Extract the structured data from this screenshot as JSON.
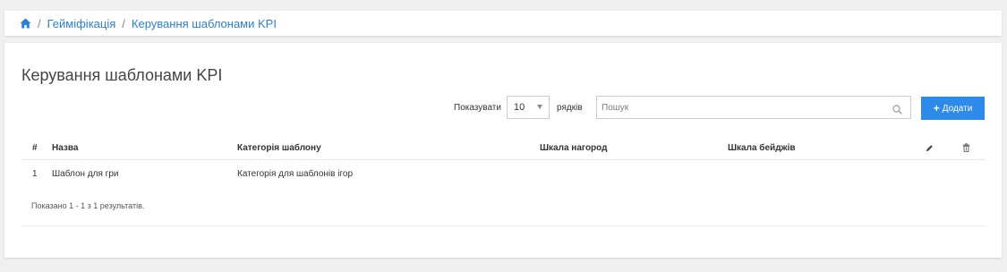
{
  "breadcrumb": {
    "home_icon": "home-icon",
    "separator": "/",
    "items": [
      "Геймiфiкацiя",
      "Керування шаблонами KPI"
    ]
  },
  "page": {
    "title": "Керування шаблонами KPI"
  },
  "controls": {
    "show_label": "Показувати",
    "page_size": "10",
    "rows_label": "рядкiв",
    "search_placeholder": "Пошук",
    "search_icon": "search-icon",
    "add_label": "Додати",
    "add_icon": "plus-icon"
  },
  "table": {
    "columns": {
      "num": "#",
      "name": "Назва",
      "category": "Категорiя шаблону",
      "reward_scale": "Шкала нагород",
      "badge_scale": "Шкала бейджiв",
      "edit_icon": "pencil-icon",
      "delete_icon": "trash-icon"
    },
    "rows": [
      {
        "num": "1",
        "name": "Шаблон для гри",
        "category": "Категорiя для шаблонiв iгор",
        "reward_scale": "",
        "badge_scale": ""
      }
    ],
    "summary": "Показано 1 - 1 з 1 результатiв."
  },
  "colors": {
    "accent": "#2d8ae8",
    "link": "#2d7fd3",
    "background": "#f0f0f0"
  }
}
